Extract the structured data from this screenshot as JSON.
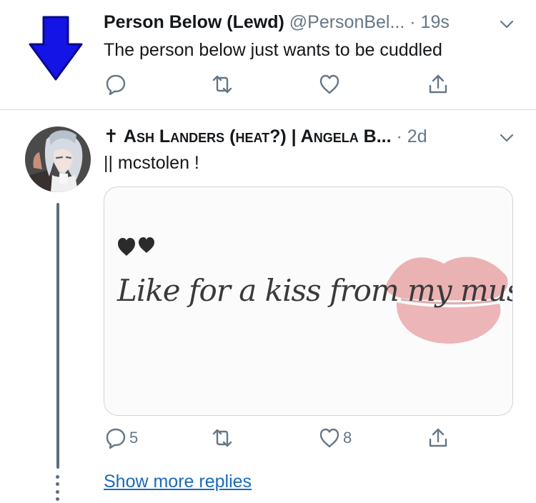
{
  "tweets": [
    {
      "display_name": "Person Below (Lewd)",
      "handle": "@PersonBel...",
      "separator": " · ",
      "time": "19s",
      "text": "The person below just wants to be cuddled",
      "avatar_icon": "down-arrow-icon",
      "avatar_color": "#1414e6",
      "actions": {
        "reply_count": "",
        "retweet_count": "",
        "like_count": ""
      }
    },
    {
      "display_name_prefix": "✝",
      "display_name": "Ash Landers (heat?) | Angela B...",
      "separator": " · ",
      "time": "2d",
      "text": "|| mcstolen !",
      "avatar_icon": "anime-character-avatar",
      "media": {
        "caption": "Like for a kiss from my muse"
      },
      "actions": {
        "reply_count": "5",
        "retweet_count": "",
        "like_count": "8"
      }
    }
  ],
  "show_more": "Show more replies",
  "colors": {
    "icon_gray": "#657786",
    "link_blue": "#1b6bb8",
    "thread_line": "#5d6d7e",
    "lips_pink": "#e8a5a7"
  }
}
